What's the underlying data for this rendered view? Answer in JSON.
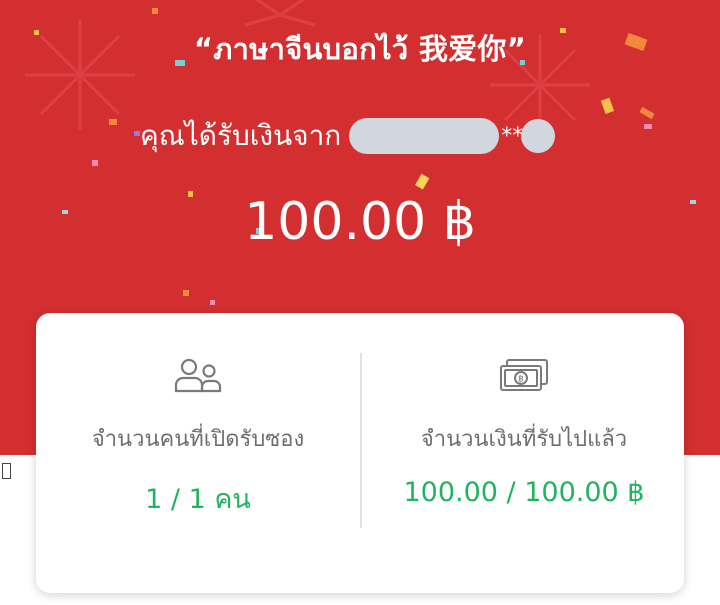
{
  "header": {
    "message": "“ภาษาจีนบอกไว้ 我爱你”",
    "received_from_label": "คุณได้รับเงินจาก",
    "masked_suffix": "**",
    "amount": "100.00 ฿"
  },
  "stats": {
    "openers_label": "จำนวนคนที่เปิดรับซอง",
    "openers_value": "1 / 1 คน",
    "amount_label": "จำนวนเงินที่รับไปแล้ว",
    "amount_value": "100.00 / 100.00 ฿"
  },
  "colors": {
    "background_red": "#d42f30",
    "value_green": "#22b35e",
    "mask_gray": "#d2d6de"
  },
  "icons": {
    "openers_icon": "people-icon",
    "amount_icon": "banknote-icon"
  }
}
